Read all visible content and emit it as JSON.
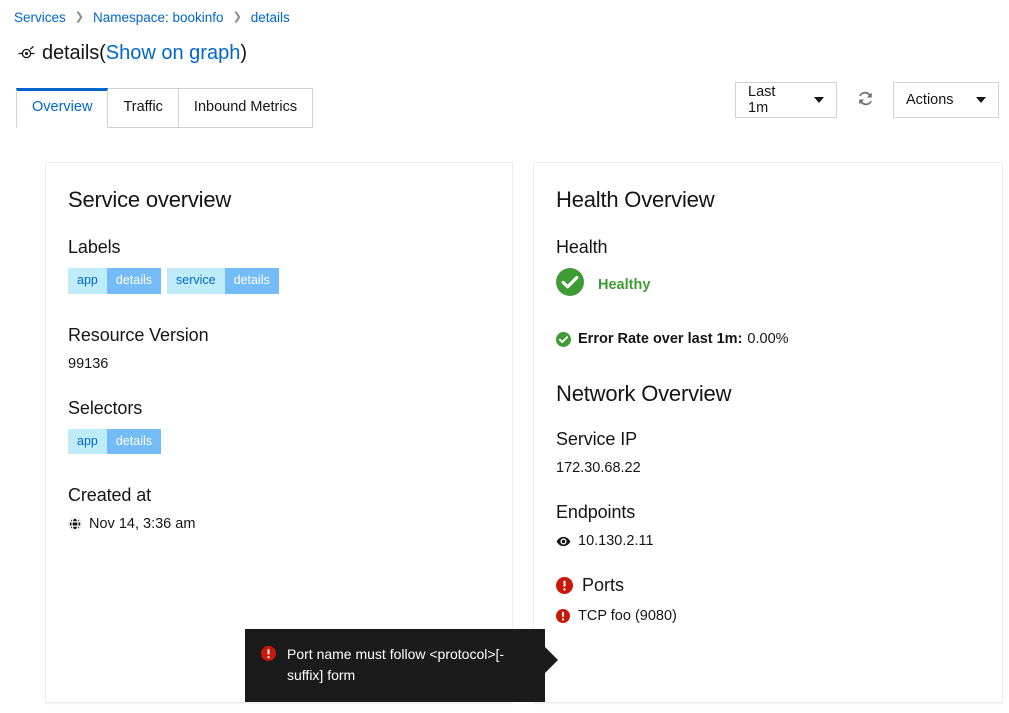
{
  "breadcrumb": {
    "items": [
      {
        "label": "Services",
        "type": "link"
      },
      {
        "label": "Namespace: bookinfo",
        "type": "link"
      },
      {
        "label": "details",
        "type": "current"
      }
    ],
    "separator": "❯"
  },
  "header": {
    "icon": "service-topology-icon",
    "title": "details",
    "paren_open": "(",
    "show_on_graph_label": "Show on graph",
    "paren_close": ")"
  },
  "tabs": [
    {
      "label": "Overview",
      "active": true
    },
    {
      "label": "Traffic",
      "active": false
    },
    {
      "label": "Inbound Metrics",
      "active": false
    }
  ],
  "toolbar": {
    "duration_value": "Last 1m",
    "refresh_icon": "refresh-icon",
    "actions_label": "Actions"
  },
  "service_overview": {
    "card_title": "Service overview",
    "labels_title": "Labels",
    "labels": [
      {
        "key": "app",
        "value": "details"
      },
      {
        "key": "service",
        "value": "details"
      }
    ],
    "resource_version_title": "Resource Version",
    "resource_version_value": "99136",
    "selectors_title": "Selectors",
    "selectors": [
      {
        "key": "app",
        "value": "details"
      }
    ],
    "created_at_title": "Created at",
    "created_at_icon": "globe-icon",
    "created_at_value": "Nov 14, 3:36 am"
  },
  "health_overview": {
    "card_title": "Health Overview",
    "health_title": "Health",
    "health_status_icon": "check-circle-icon",
    "health_status": "Healthy",
    "error_rate_icon": "check-circle-icon",
    "error_rate_label": "Error Rate over last 1m:",
    "error_rate_value": "0.00%"
  },
  "network_overview": {
    "card_title": "Network Overview",
    "service_ip_title": "Service IP",
    "service_ip_value": "172.30.68.22",
    "endpoints_title": "Endpoints",
    "endpoint_icon": "eye-icon",
    "endpoints_value": "10.130.2.11",
    "ports_title": "Ports",
    "ports_icon": "error-circle-icon",
    "ports": [
      {
        "icon": "error-circle-icon",
        "label": "TCP foo (9080)"
      }
    ]
  },
  "tooltip": {
    "icon": "error-circle-icon",
    "text": "Port name must follow <protocol>[-suffix] form"
  },
  "colors": {
    "link": "#0066cc",
    "healthy_green": "#3f9c35",
    "error_red": "#c9190b",
    "badge_key_bg": "#beedf9",
    "badge_value_bg": "#73bcf7",
    "tooltip_bg": "#1b1b1b"
  }
}
